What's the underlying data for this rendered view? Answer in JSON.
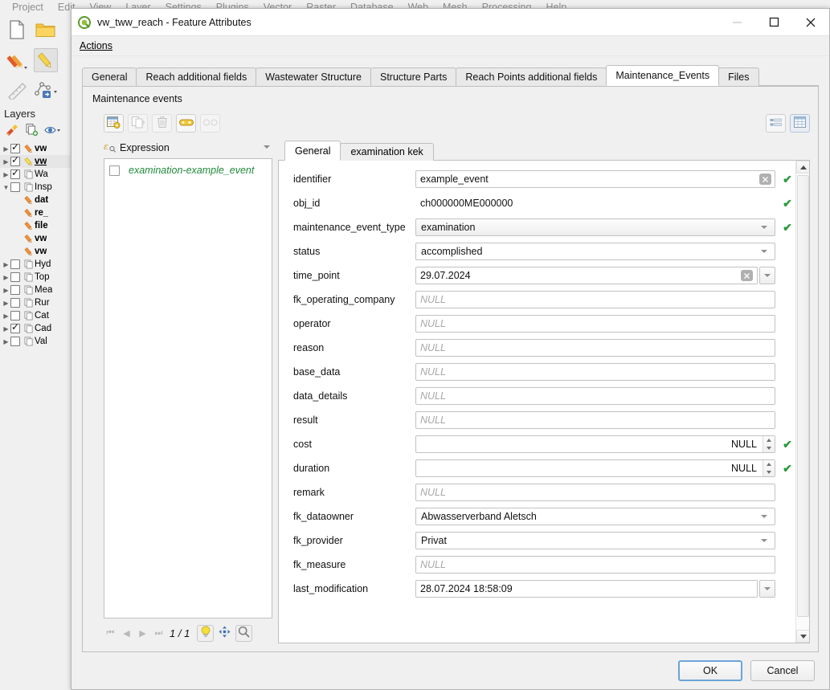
{
  "app": {
    "menubar": [
      "Project",
      "Edit",
      "View",
      "Layer",
      "Settings",
      "Plugins",
      "Vector",
      "Raster",
      "Database",
      "Web",
      "Mesh",
      "Processing",
      "Help"
    ],
    "panel_title": "Layers",
    "layers": [
      {
        "label": "vw",
        "checked": true,
        "bold": true,
        "underline": false,
        "expandable": true,
        "expanded": false,
        "icon": "pencil-icon",
        "selected": false
      },
      {
        "label": "vw",
        "checked": true,
        "bold": true,
        "underline": true,
        "expandable": true,
        "expanded": false,
        "icon": "pencil-edit-icon",
        "selected": true
      },
      {
        "label": "Wa",
        "checked": true,
        "bold": false,
        "underline": false,
        "expandable": true,
        "expanded": false,
        "icon": "group-icon",
        "selected": false
      },
      {
        "label": "Insp",
        "checked": false,
        "bold": false,
        "underline": false,
        "expandable": true,
        "expanded": true,
        "icon": "group-icon",
        "selected": false
      },
      {
        "label": "dat",
        "checked": null,
        "bold": true,
        "underline": false,
        "expandable": false,
        "expanded": false,
        "icon": "pencil-icon",
        "selected": false
      },
      {
        "label": "re_",
        "checked": null,
        "bold": true,
        "underline": false,
        "expandable": false,
        "expanded": false,
        "icon": "pencil-icon",
        "selected": false
      },
      {
        "label": "file",
        "checked": null,
        "bold": true,
        "underline": false,
        "expandable": false,
        "expanded": false,
        "icon": "pencil-icon",
        "selected": false
      },
      {
        "label": "vw",
        "checked": null,
        "bold": true,
        "underline": false,
        "expandable": false,
        "expanded": false,
        "icon": "pencil-icon",
        "selected": false
      },
      {
        "label": "vw",
        "checked": null,
        "bold": true,
        "underline": false,
        "expandable": false,
        "expanded": false,
        "icon": "pencil-icon",
        "selected": false
      },
      {
        "label": "Hyd",
        "checked": false,
        "bold": false,
        "underline": false,
        "expandable": true,
        "expanded": false,
        "icon": "group-icon",
        "selected": false
      },
      {
        "label": "Top",
        "checked": false,
        "bold": false,
        "underline": false,
        "expandable": true,
        "expanded": false,
        "icon": "group-icon",
        "selected": false
      },
      {
        "label": "Mea",
        "checked": false,
        "bold": false,
        "underline": false,
        "expandable": true,
        "expanded": false,
        "icon": "group-icon",
        "selected": false
      },
      {
        "label": "Rur",
        "checked": false,
        "bold": false,
        "underline": false,
        "expandable": true,
        "expanded": false,
        "icon": "group-icon",
        "selected": false
      },
      {
        "label": "Cat",
        "checked": false,
        "bold": false,
        "underline": false,
        "expandable": true,
        "expanded": false,
        "icon": "group-icon",
        "selected": false
      },
      {
        "label": "Cad",
        "checked": true,
        "bold": false,
        "underline": false,
        "expandable": true,
        "expanded": false,
        "icon": "group-icon",
        "selected": false
      },
      {
        "label": "Val",
        "checked": false,
        "bold": false,
        "underline": false,
        "expandable": true,
        "expanded": false,
        "icon": "group-icon",
        "selected": false
      }
    ]
  },
  "dialog": {
    "title": "vw_tww_reach - Feature Attributes",
    "menu": {
      "actions": "Actions"
    },
    "window_buttons": {
      "minimize": "—",
      "maximize": "□",
      "close": "✕"
    },
    "tabs": [
      {
        "label": "General",
        "active": false
      },
      {
        "label": "Reach additional fields",
        "active": false
      },
      {
        "label": "Wastewater Structure",
        "active": false
      },
      {
        "label": "Structure Parts",
        "active": false
      },
      {
        "label": "Reach Points additional fields",
        "active": false
      },
      {
        "label": "Maintenance_Events",
        "active": true
      },
      {
        "label": "Files",
        "active": false
      }
    ],
    "section_label": "Maintenance events",
    "relation_toolbar": [
      {
        "name": "add-child-feature-button",
        "enabled": true,
        "icon": "new-table-record-icon"
      },
      {
        "name": "duplicate-child-feature-button",
        "enabled": false,
        "icon": "duplicate-icon"
      },
      {
        "name": "delete-child-feature-button",
        "enabled": false,
        "icon": "trash-icon"
      },
      {
        "name": "link-feature-button",
        "enabled": true,
        "icon": "link-icon"
      },
      {
        "name": "unlink-feature-button",
        "enabled": false,
        "icon": "unlink-icon"
      }
    ],
    "view_toggle": [
      {
        "name": "form-view-button",
        "icon": "form-view-icon",
        "active": false
      },
      {
        "name": "table-view-button",
        "icon": "table-view-icon",
        "active": true
      }
    ],
    "expression": {
      "label": "Expression",
      "icon": "expression-icon"
    },
    "feature_list": [
      {
        "label": "examination-example_event",
        "checked": false
      }
    ],
    "list_nav": {
      "first": "⏮",
      "prev": "◀",
      "next": "▶",
      "last": "⏭",
      "counter": "1 / 1",
      "tools": [
        {
          "name": "highlight-feature-button",
          "icon": "lightbulb-icon",
          "active": true
        },
        {
          "name": "pan-to-feature-button",
          "icon": "pan-icon",
          "active": false
        },
        {
          "name": "zoom-to-feature-button",
          "icon": "zoom-icon",
          "active": true
        }
      ]
    },
    "inner_tabs": [
      {
        "label": "General",
        "active": true
      },
      {
        "label": "examination kek",
        "active": false
      }
    ],
    "form_fields": [
      {
        "label": "identifier",
        "type": "text-clear",
        "value": "example_event",
        "placeholder": "",
        "valid": true
      },
      {
        "label": "obj_id",
        "type": "text-flat",
        "value": "ch000000ME000000",
        "placeholder": "",
        "valid": true
      },
      {
        "label": "maintenance_event_type",
        "type": "combo",
        "value": "examination",
        "placeholder": "",
        "valid": true
      },
      {
        "label": "status",
        "type": "combo-white",
        "value": "accomplished",
        "placeholder": "",
        "valid": false
      },
      {
        "label": "time_point",
        "type": "date",
        "value": "29.07.2024",
        "placeholder": "",
        "valid": false
      },
      {
        "label": "fk_operating_company",
        "type": "text",
        "value": "",
        "placeholder": "NULL",
        "valid": false
      },
      {
        "label": "operator",
        "type": "text",
        "value": "",
        "placeholder": "NULL",
        "valid": false
      },
      {
        "label": "reason",
        "type": "text",
        "value": "",
        "placeholder": "NULL",
        "valid": false
      },
      {
        "label": "base_data",
        "type": "text",
        "value": "",
        "placeholder": "NULL",
        "valid": false
      },
      {
        "label": "data_details",
        "type": "text",
        "value": "",
        "placeholder": "NULL",
        "valid": false
      },
      {
        "label": "result",
        "type": "text",
        "value": "",
        "placeholder": "NULL",
        "valid": false
      },
      {
        "label": "cost",
        "type": "spin",
        "value": "NULL",
        "placeholder": "",
        "valid": true
      },
      {
        "label": "duration",
        "type": "spin",
        "value": "NULL",
        "placeholder": "",
        "valid": true
      },
      {
        "label": "remark",
        "type": "text",
        "value": "",
        "placeholder": "NULL",
        "valid": false
      },
      {
        "label": "fk_dataowner",
        "type": "combo-white",
        "value": "Abwasserverband Aletsch",
        "placeholder": "",
        "valid": false
      },
      {
        "label": "fk_provider",
        "type": "combo-white",
        "value": "Privat",
        "placeholder": "",
        "valid": false
      },
      {
        "label": "fk_measure",
        "type": "text",
        "value": "",
        "placeholder": "NULL",
        "valid": false
      },
      {
        "label": "last_modification",
        "type": "date",
        "value": "28.07.2024 18:58:09",
        "placeholder": "",
        "valid": false
      }
    ],
    "footer": {
      "ok": "OK",
      "cancel": "Cancel"
    }
  },
  "colors": {
    "valid_check": "#2a9b3f",
    "feature_text": "#1f8a3b",
    "dialog_bg": "#f0f0f0",
    "focus_border": "#6ba4d8"
  }
}
